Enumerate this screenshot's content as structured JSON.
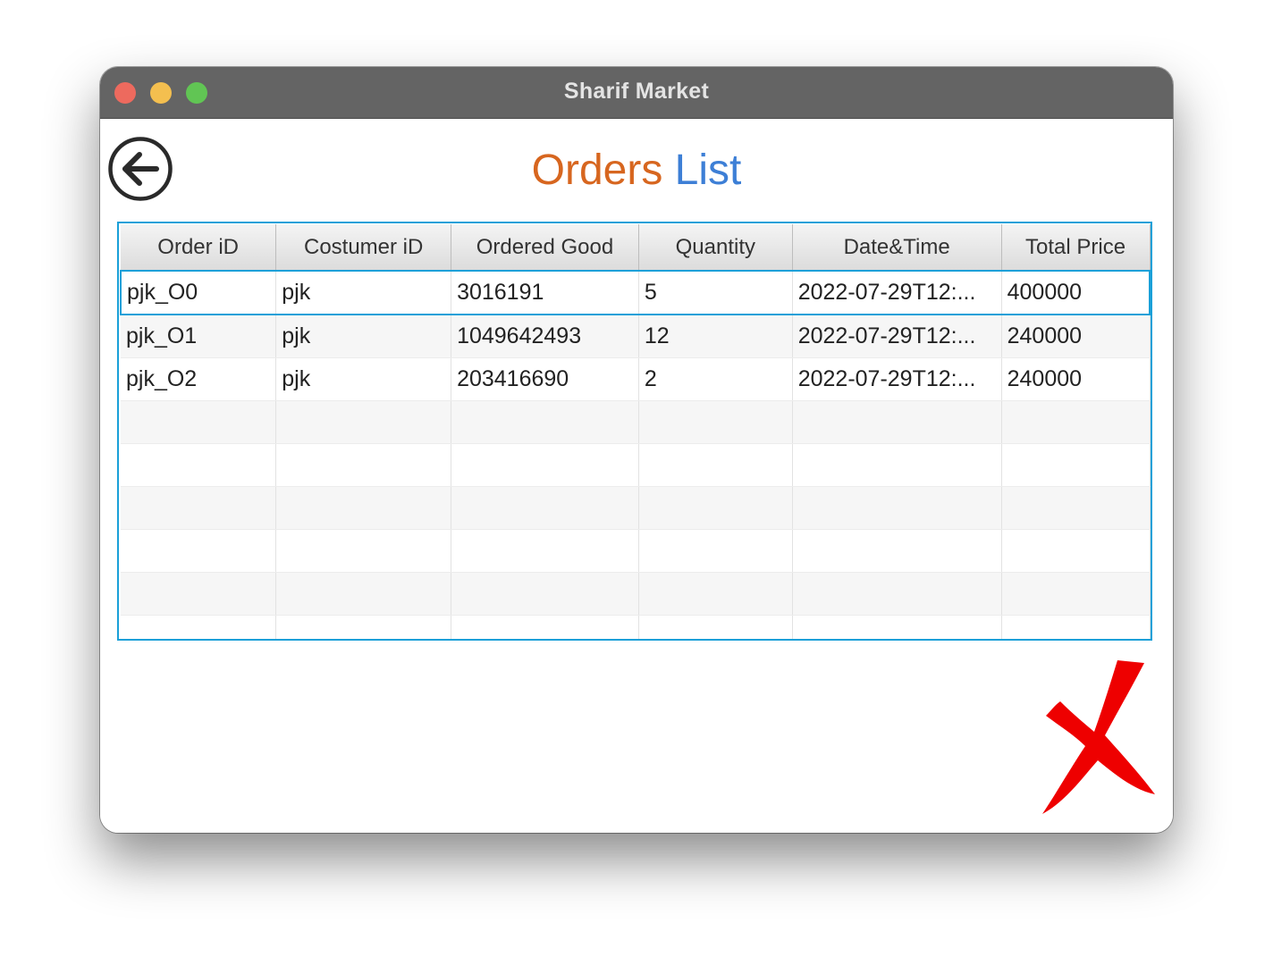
{
  "window": {
    "title": "Sharif Market"
  },
  "header": {
    "title_part1": "Orders",
    "title_part2": "List",
    "title_part1_color": "#d7661f",
    "title_part2_color": "#3d7fd6",
    "back_icon": "arrow-left-circle-icon"
  },
  "table": {
    "columns": [
      "Order iD",
      "Costumer iD",
      "Ordered Good",
      "Quantity",
      "Date&Time",
      "Total Price"
    ],
    "rows": [
      [
        "pjk_O0",
        "pjk",
        "3016191",
        "5",
        "2022-07-29T12:...",
        "400000"
      ],
      [
        "pjk_O1",
        "pjk",
        "1049642493",
        "12",
        "2022-07-29T12:...",
        "240000"
      ],
      [
        "pjk_O2",
        "pjk",
        "203416690",
        "2",
        "2022-07-29T12:...",
        "240000"
      ]
    ],
    "selected_row": 0,
    "accent_color": "#1aa0d8"
  },
  "actions": {
    "close_icon": "red-x-icon",
    "close_color": "#ee0000"
  }
}
